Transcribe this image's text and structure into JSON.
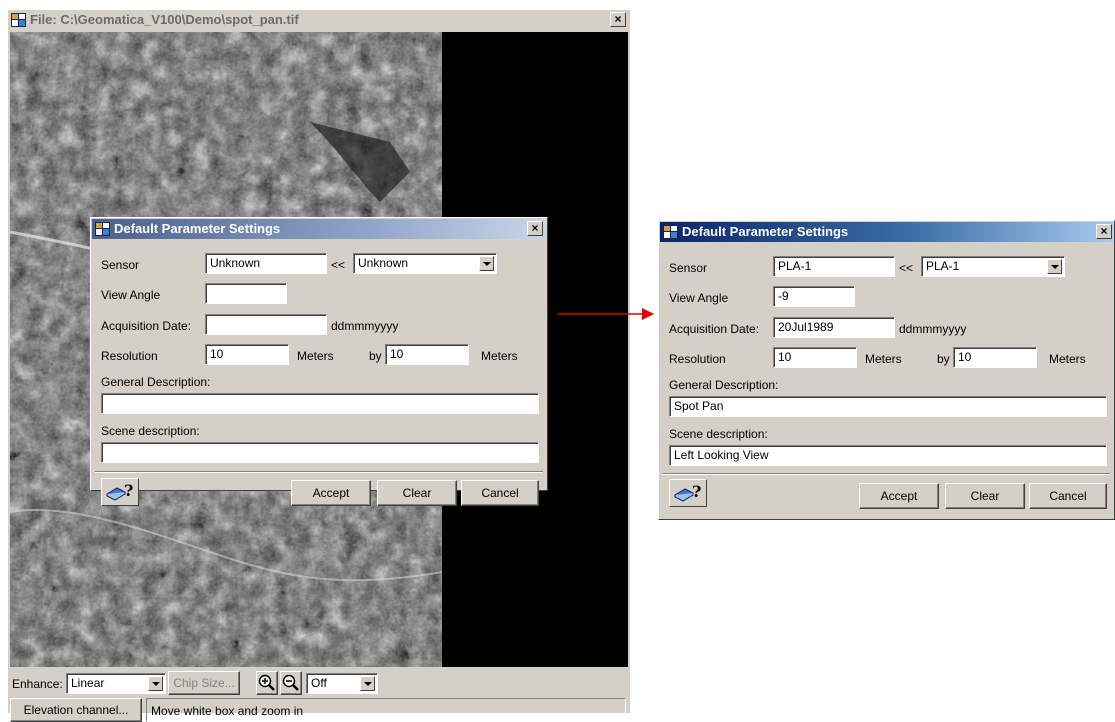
{
  "main_window": {
    "title": "File: C:\\Geomatica_V100\\Demo\\spot_pan.tif",
    "close_label": "×",
    "enhance_label": "Enhance:",
    "enhance_value": "Linear",
    "chip_size_label": "Chip Size...",
    "zoom_mode_value": "Off",
    "elevation_button": "Elevation channel...",
    "status_text": "Move white box and zoom in"
  },
  "dialog_left": {
    "title": "Default Parameter Settings",
    "close_label": "×",
    "sensor_label": "Sensor",
    "sensor_value": "Unknown",
    "copy_arrow": "<<",
    "sensor_combo_value": "Unknown",
    "view_angle_label": "View Angle",
    "view_angle_value": "",
    "acq_date_label": "Acquisition Date:",
    "acq_date_value": "",
    "date_format": "ddmmmyyyy",
    "resolution_label": "Resolution",
    "res_x_value": "10",
    "meters_label_1": "Meters",
    "by_label": "by",
    "res_y_value": "10",
    "meters_label_2": "Meters",
    "general_desc_label": "General Description:",
    "general_desc_value": "",
    "scene_desc_label": "Scene description:",
    "scene_desc_value": "",
    "help_label": "?",
    "accept_label": "Accept",
    "clear_label": "Clear",
    "cancel_label": "Cancel"
  },
  "dialog_right": {
    "title": "Default Parameter Settings",
    "close_label": "×",
    "sensor_label": "Sensor",
    "sensor_value": "PLA-1",
    "copy_arrow": "<<",
    "sensor_combo_value": "PLA-1",
    "view_angle_label": "View Angle",
    "view_angle_value": "-9",
    "acq_date_label": "Acquisition Date:",
    "acq_date_value": "20Jul1989",
    "date_format": "ddmmmyyyy",
    "resolution_label": "Resolution",
    "res_x_value": "10",
    "meters_label_1": "Meters",
    "by_label": "by",
    "res_y_value": "10",
    "meters_label_2": "Meters",
    "general_desc_label": "General Description:",
    "general_desc_value": "Spot Pan",
    "scene_desc_label": "Scene description:",
    "scene_desc_value": "Left Looking View",
    "help_label": "?",
    "accept_label": "Accept",
    "clear_label": "Clear",
    "cancel_label": "Cancel"
  },
  "colors": {
    "window_bg": "#d4d0c8",
    "titlebar_active": "#0a246a",
    "arrow": "#e00000"
  }
}
